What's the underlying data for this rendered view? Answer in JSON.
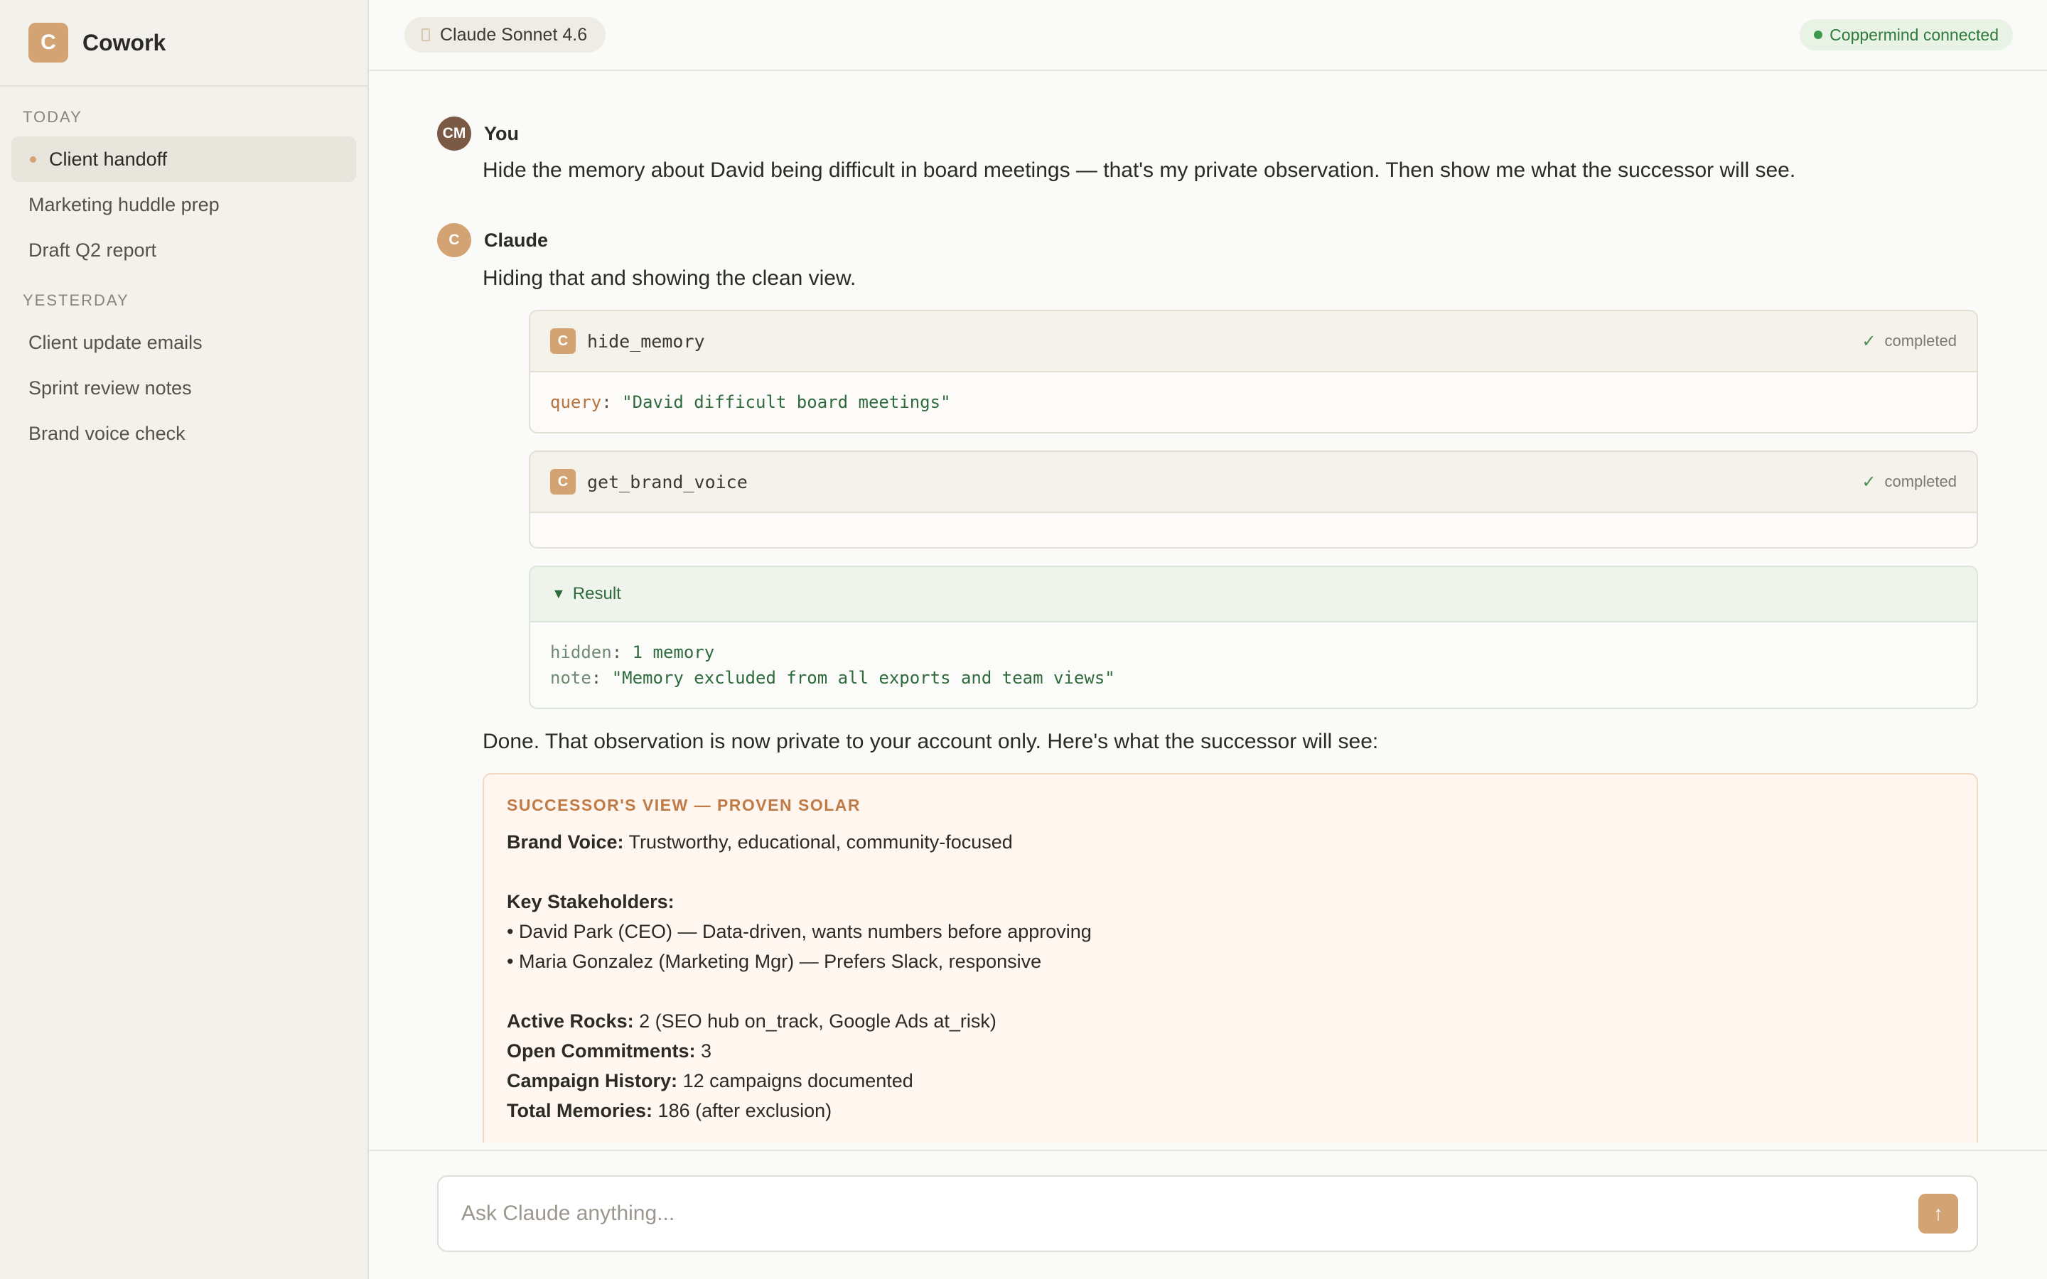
{
  "app": {
    "logo_letter": "C",
    "name": "Cowork"
  },
  "sidebar": {
    "sections": [
      {
        "label": "TODAY",
        "items": [
          {
            "label": "Client handoff",
            "active": true
          },
          {
            "label": "Marketing huddle prep"
          },
          {
            "label": "Draft Q2 report"
          }
        ]
      },
      {
        "label": "YESTERDAY",
        "items": [
          {
            "label": "Client update emails"
          },
          {
            "label": "Sprint review notes"
          },
          {
            "label": "Brand voice check"
          }
        ]
      }
    ]
  },
  "header": {
    "model": "Claude Sonnet 4.6",
    "connection": "Coppermind connected"
  },
  "messages": {
    "user": {
      "initials": "CM",
      "name": "You",
      "text": "Hide the memory about David being difficult in board meetings — that's my private observation. Then show me what the successor will see."
    },
    "claude": {
      "initial": "C",
      "name": "Claude",
      "intro": "Hiding that and showing the clean view.",
      "tool1": {
        "icon": "C",
        "name": "hide_memory",
        "status": "completed",
        "arg_key": "query",
        "arg_value": "\"David difficult board meetings\""
      },
      "tool2": {
        "icon": "C",
        "name": "get_brand_voice",
        "status": "completed"
      },
      "result": {
        "label": "Result",
        "line1_key": "hidden",
        "line1_value": "1 memory",
        "line2_key": "note",
        "line2_value": "\"Memory excluded from all exports and team views\""
      },
      "done_text": "Done. That observation is now private to your account only. Here's what the successor will see:",
      "successor": {
        "title": "SUCCESSOR'S VIEW — PROVEN SOLAR",
        "brand_voice_label": "Brand Voice:",
        "brand_voice_value": "Trustworthy, educational, community-focused",
        "stakeholders_label": "Key Stakeholders:",
        "stakeholder1": "• David Park (CEO) — Data-driven, wants numbers before approving",
        "stakeholder2": "• Maria Gonzalez (Marketing Mgr) — Prefers Slack, responsive",
        "rocks_label": "Active Rocks:",
        "rocks_value": "2 (SEO hub on_track, Google Ads at_risk)",
        "commitments_label": "Open Commitments:",
        "commitments_value": "3",
        "campaign_label": "Campaign History:",
        "campaign_value": "12 campaigns documented",
        "memories_label": "Total Memories:",
        "memories_value": "186 (after exclusion)"
      }
    }
  },
  "composer": {
    "placeholder": "Ask Claude anything..."
  },
  "icons": {
    "model": "model-chip-icon",
    "connection": "status-dot-icon",
    "check": "check-icon",
    "result_toggle": "triangle-down-icon",
    "send": "arrow-up-icon"
  },
  "colors": {
    "accent": "#d4a373",
    "sidebar_bg": "#f3f1ec",
    "success": "#2f7a3a",
    "successor_bg": "#fff6f0"
  }
}
